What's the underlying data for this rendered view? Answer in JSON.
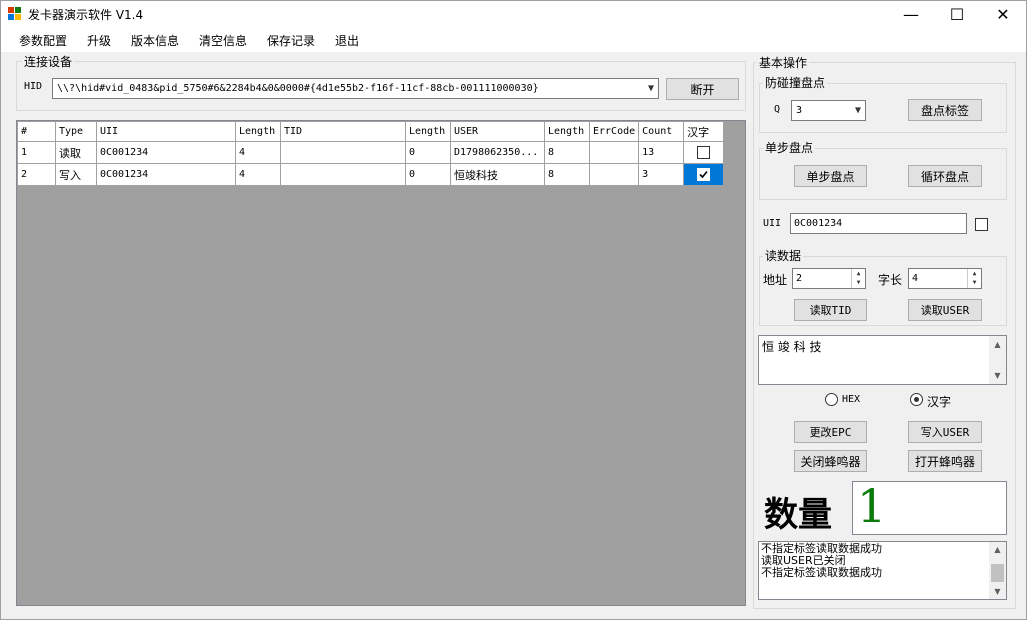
{
  "window": {
    "title": "发卡器演示软件 V1.4",
    "controls": {
      "minimize": "—",
      "maximize": "☐",
      "close": "✕"
    }
  },
  "menu": [
    "参数配置",
    "升级",
    "版本信息",
    "清空信息",
    "保存记录",
    "退出"
  ],
  "connect": {
    "group_title": "连接设备",
    "port_label": "HID",
    "device_path": "\\\\?\\hid#vid_0483&pid_5750#6&2284b4&0&0000#{4d1e55b2-f16f-11cf-88cb-001111000030}",
    "disconnect_button": "断开"
  },
  "grid": {
    "columns": [
      "#",
      "Type",
      "UII",
      "Length",
      "TID",
      "Length",
      "USER",
      "Length",
      "ErrCode",
      "Count",
      "汉字"
    ],
    "rows": [
      {
        "num": "1",
        "type": "读取",
        "uii": "0C001234",
        "len1": "4",
        "tid": "",
        "len2": "0",
        "user": "D1798062350...",
        "len3": "8",
        "err": "",
        "count": "13",
        "hanzi_checked": false
      },
      {
        "num": "2",
        "type": "写入",
        "uii": "0C001234",
        "len1": "4",
        "tid": "",
        "len2": "0",
        "user": "恒竣科技",
        "len3": "8",
        "err": "",
        "count": "3",
        "hanzi_checked": true
      }
    ]
  },
  "basic_ops": {
    "group_title": "基本操作",
    "anticollision": {
      "title": "防碰撞盘点",
      "q_label": "Q",
      "q_value": "3",
      "inventory_button": "盘点标签"
    },
    "single_step": {
      "title": "单步盘点",
      "single_button": "单步盘点",
      "loop_button": "循环盘点"
    },
    "uii": {
      "label": "UII",
      "value": "0C001234"
    },
    "read_data": {
      "title": "读数据",
      "addr_label": "地址",
      "addr_value": "2",
      "len_label": "字长",
      "len_value": "4",
      "read_tid_button": "读取TID",
      "read_user_button": "读取USER"
    },
    "data_text": "恒 竣 科 技",
    "format": {
      "hex_label": "HEX",
      "hanzi_label": "汉字",
      "selected": "汉字"
    },
    "change_epc_button": "更改EPC",
    "write_user_button": "写入USER",
    "close_buzzer_button": "关闭蜂鸣器",
    "open_buzzer_button": "打开蜂鸣器",
    "count_label": "数量",
    "count_value": "1",
    "log": [
      "不指定标签读取数据成功",
      "读取USER已关闭",
      "不指定标签读取数据成功"
    ]
  },
  "colors": {
    "accent": "#0078d7",
    "count_green": "#0a7a0a"
  }
}
